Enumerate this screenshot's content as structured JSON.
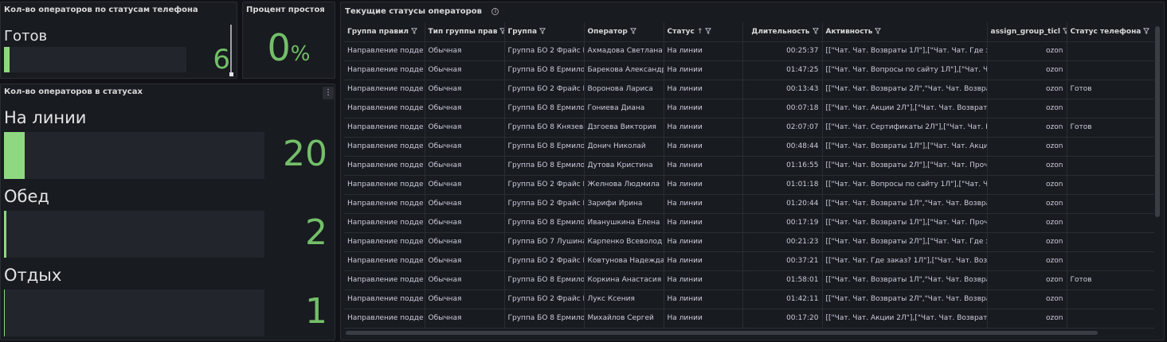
{
  "panel1": {
    "title": "Кол-во операторов по статусам телефона",
    "label": "Готов",
    "value": "6",
    "fill_fraction": 0.03
  },
  "panel2": {
    "title": "Процент простоя",
    "value": "0",
    "unit": "%"
  },
  "panel3": {
    "title": "Кол-во операторов в статусах",
    "items": [
      {
        "label": "На линии",
        "value": "20",
        "fill_fraction": 0.08
      },
      {
        "label": "Обед",
        "value": "2",
        "fill_fraction": 0.008
      },
      {
        "label": "Отдых",
        "value": "1",
        "fill_fraction": 0.004
      }
    ]
  },
  "panel4": {
    "title": "Текущие статусы операторов",
    "info_icon": "info-circle-icon",
    "columns": [
      "Группа правил",
      "Тип группы прав",
      "Группа",
      "Оператор",
      "Статус",
      "Длительность",
      "Активность",
      "assign_group_ticl",
      "Статус телефона"
    ],
    "sorted_column": "Статус",
    "rows": [
      [
        "Направление подде",
        "Обычная",
        "Группа БО 2 Фрайс Н",
        "Ахмадова Светлана",
        "На линии",
        "00:25:37",
        "[[\"Чат. Чат. Возвраты 1Л\"],[\"Чат. Чат. Где за",
        "ozon",
        ""
      ],
      [
        "Направление подде",
        "Обычная",
        "Группа БО 8 Ермило",
        "Барекова Александр",
        "На линии",
        "01:47:25",
        "[[\"Чат. Чат. Вопросы по сайту 1Л\"],[\"Чат. Ча",
        "ozon",
        ""
      ],
      [
        "Направление подде",
        "Обычная",
        "Группа БО 2 Фрайс Н",
        "Воронова Лариса",
        "На линии",
        "00:13:43",
        "[[\"Чат. Чат. Возвраты 2Л\",\"Чат. Чат. Возврат",
        "ozon",
        "Готов"
      ],
      [
        "Направление подде",
        "Обычная",
        "Группа БО 8 Ермило",
        "Гониева Диана",
        "На линии",
        "00:07:18",
        "[[\"Чат. Чат. Акции 2Л\"],[\"Чат. Чат. Возврат",
        "ozon",
        ""
      ],
      [
        "Направление подде",
        "Обычная",
        "Группа БО 8 Князева",
        "Дзгоева Виктория",
        "На линии",
        "02:07:07",
        "[[\"Чат. Чат. Сертификаты 2Л\"],[\"Чат. Чат. Гд",
        "ozon",
        "Готов"
      ],
      [
        "Направление подде",
        "Обычная",
        "Группа БО 8 Ермило",
        "Донич Николай",
        "На линии",
        "00:48:44",
        "[[\"Чат. Чат. Возвраты 1Л\"],[\"Чат. Чат. Акци",
        "ozon",
        ""
      ],
      [
        "Направление подде",
        "Обычная",
        "Группа БО 8 Ермило",
        "Дутова Кристина",
        "На линии",
        "01:16:55",
        "[[\"Чат. Чат. Возвраты 2Л\"],[\"Чат. Чат. Проче",
        "ozon",
        ""
      ],
      [
        "Направление подде",
        "Обычная",
        "Группа БО 2 Фрайс Н",
        "Желнова Людмила",
        "На линии",
        "01:01:18",
        "[[\"Чат. Чат. Вопросы по сайту 1Л\"],[\"Чат. Ча",
        "ozon",
        ""
      ],
      [
        "Направление подде",
        "Обычная",
        "Группа БО 2 Фрайс Н",
        "Зарифи Ирина",
        "На линии",
        "01:20:44",
        "[[\"Чат. Чат. Возвраты 1Л\",\"Чат. Чат. Возврат",
        "ozon",
        ""
      ],
      [
        "Направление подде",
        "Обычная",
        "Группа БО 8 Ермило",
        "Иванушкина Елена",
        "На линии",
        "00:17:19",
        "[[\"Чат. Чат. Возвраты 1Л\"],[\"Чат. Чат. Проче",
        "ozon",
        ""
      ],
      [
        "Направление подде",
        "Обычная",
        "Группа БО 7 Лушина",
        "Карпенко Всеволод",
        "На линии",
        "00:21:23",
        "[[\"Чат. Чат. Возвраты 2Л\"],[\"Чат. Чат. Где за",
        "ozon",
        ""
      ],
      [
        "Направление подде",
        "Обычная",
        "Группа БО 2 Фрайс Н",
        "Ковтунова Надежда",
        "На линии",
        "00:37:21",
        "[[\"Чат. Чат. Где заказ? 1Л\"],[\"Чат. Чат. Возвра",
        "ozon",
        ""
      ],
      [
        "Направление подде",
        "Обычная",
        "Группа БО 8 Ермило",
        "Коркина Анастасия",
        "На линии",
        "01:58:01",
        "[[\"Чат. Чат. Возвраты 1Л\",\"Чат. Чат. Возврат",
        "ozon",
        "Готов"
      ],
      [
        "Направление подде",
        "Обычная",
        "Группа БО 2 Фрайс Н",
        "Лукс Ксения",
        "На линии",
        "01:42:11",
        "[[\"Чат. Чат. Возвраты 2Л\",\"Чат. Чат. Возврат",
        "ozon",
        ""
      ],
      [
        "Направление подде",
        "Обычная",
        "Группа БО 8 Ермило",
        "Михайлов Сергей",
        "На линии",
        "00:17:20",
        "[[\"Чат. Чат. Акции 2Л\"],[\"Чат. Чат. Возврат",
        "ozon",
        ""
      ]
    ]
  },
  "colors": {
    "accent_green": "#73bf69",
    "bar_fill": "#8fd882",
    "panel_bg": "#181b1f",
    "page_bg": "#111217"
  }
}
